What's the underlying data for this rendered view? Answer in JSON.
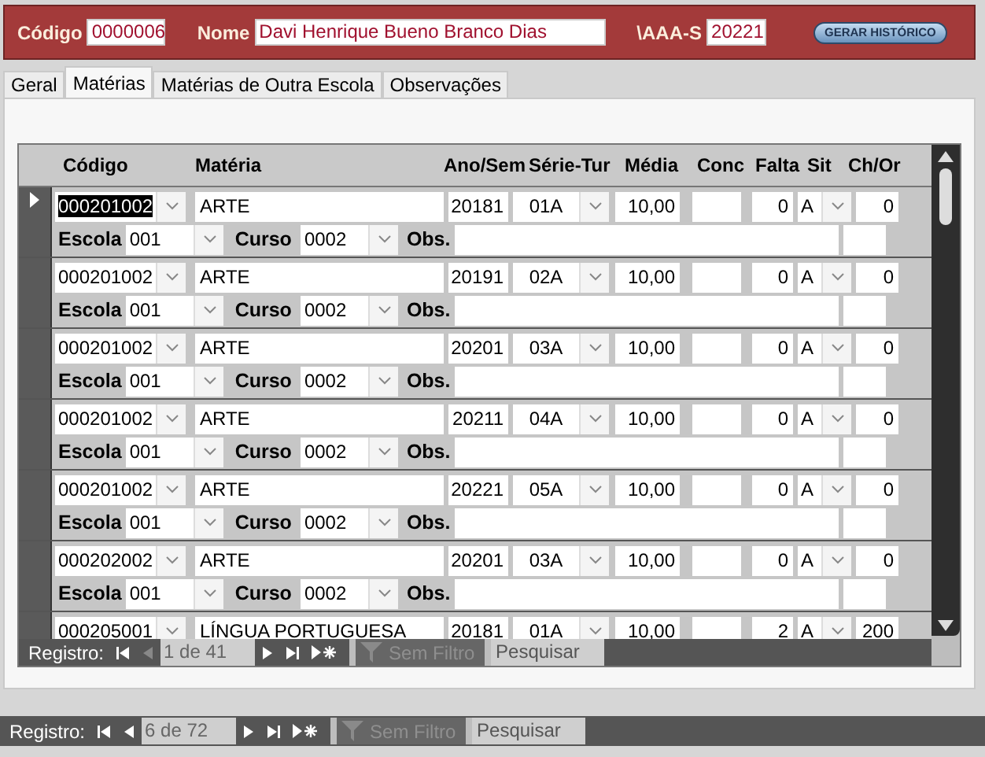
{
  "header": {
    "codigo_label": "Código",
    "codigo": "0000006",
    "nome_label": "Nome",
    "nome": "Davi Henrique Bueno Branco Dias",
    "aaa_label": "\\AAA-S",
    "aaa": "20221",
    "button": "GERAR HISTÓRICO"
  },
  "tabs": [
    {
      "label": "Geral",
      "selected": false
    },
    {
      "label": "Matérias",
      "selected": true
    },
    {
      "label": "Matérias de Outra Escola",
      "selected": false
    },
    {
      "label": "Observações",
      "selected": false
    }
  ],
  "columns": [
    "Código",
    "Matéria",
    "Ano/Sem",
    "Série-Tur",
    "Média",
    "Conc",
    "Falta",
    "Sit",
    "Ch/Or"
  ],
  "records": [
    {
      "selected": true,
      "codigo": "000201002",
      "materia": "ARTE",
      "ano": "20181",
      "serie": "01A",
      "media": "10,00",
      "falta": "0",
      "sit": "A",
      "ch": "0",
      "escola_label": "Escola",
      "escola": "001",
      "curso_label": "Curso",
      "curso": "0002",
      "obs_label": "Obs."
    },
    {
      "selected": false,
      "codigo": "000201002",
      "materia": "ARTE",
      "ano": "20191",
      "serie": "02A",
      "media": "10,00",
      "falta": "0",
      "sit": "A",
      "ch": "0",
      "escola_label": "Escola",
      "escola": "001",
      "curso_label": "Curso",
      "curso": "0002",
      "obs_label": "Obs."
    },
    {
      "selected": false,
      "codigo": "000201002",
      "materia": "ARTE",
      "ano": "20201",
      "serie": "03A",
      "media": "10,00",
      "falta": "0",
      "sit": "A",
      "ch": "0",
      "escola_label": "Escola",
      "escola": "001",
      "curso_label": "Curso",
      "curso": "0002",
      "obs_label": "Obs."
    },
    {
      "selected": false,
      "codigo": "000201002",
      "materia": "ARTE",
      "ano": "20211",
      "serie": "04A",
      "media": "10,00",
      "falta": "0",
      "sit": "A",
      "ch": "0",
      "escola_label": "Escola",
      "escola": "001",
      "curso_label": "Curso",
      "curso": "0002",
      "obs_label": "Obs."
    },
    {
      "selected": false,
      "codigo": "000201002",
      "materia": "ARTE",
      "ano": "20221",
      "serie": "05A",
      "media": "10,00",
      "falta": "0",
      "sit": "A",
      "ch": "0",
      "escola_label": "Escola",
      "escola": "001",
      "curso_label": "Curso",
      "curso": "0002",
      "obs_label": "Obs."
    },
    {
      "selected": false,
      "codigo": "000202002",
      "materia": "ARTE",
      "ano": "20201",
      "serie": "03A",
      "media": "10,00",
      "falta": "0",
      "sit": "A",
      "ch": "0",
      "escola_label": "Escola",
      "escola": "001",
      "curso_label": "Curso",
      "curso": "0002",
      "obs_label": "Obs."
    },
    {
      "selected": false,
      "codigo": "000205001",
      "materia": "LÍNGUA PORTUGUESA",
      "ano": "20181",
      "serie": "01A",
      "media": "10,00",
      "falta": "2",
      "sit": "A",
      "ch": "200"
    }
  ],
  "sub_nav": {
    "label": "Registro:",
    "position": "1 de 41",
    "at_first": true,
    "filter": "Sem Filtro",
    "search": "Pesquisar"
  },
  "main_nav": {
    "label": "Registro:",
    "position": "6 de 72",
    "at_first": false,
    "filter": "Sem Filtro",
    "search": "Pesquisar"
  }
}
